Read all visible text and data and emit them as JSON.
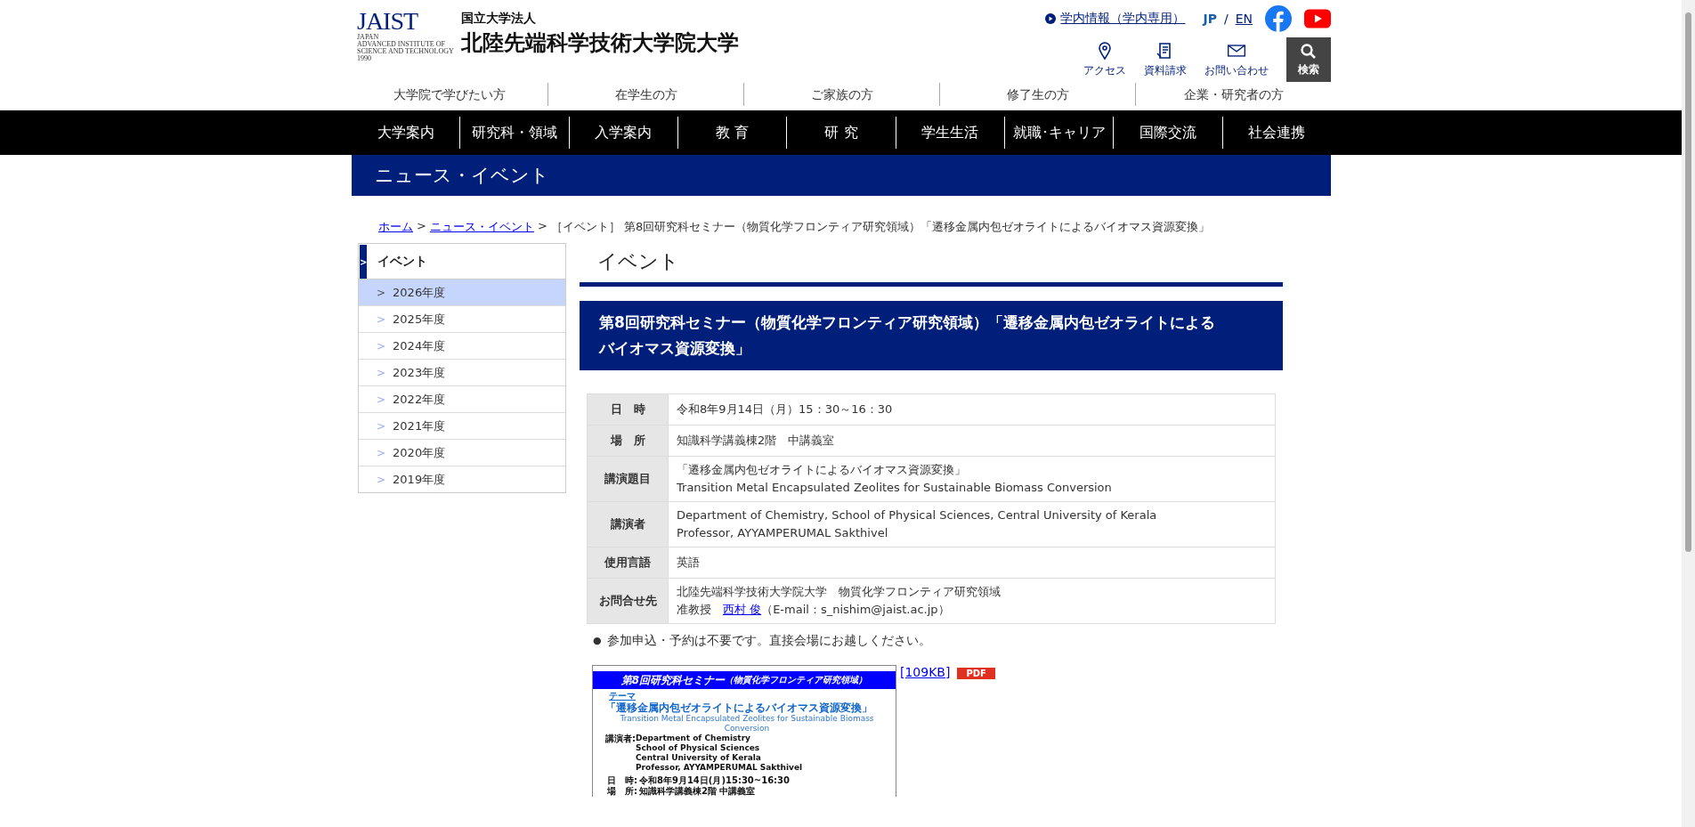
{
  "header": {
    "logo": {
      "mark": "JAIST",
      "lines": [
        "JAPAN",
        "ADVANCED INSTITUTE OF",
        "SCIENCE AND TECHNOLOGY",
        "1990"
      ]
    },
    "subtitle": "国立大学法人",
    "title": "北陸先端科学技術大学院大学",
    "internal_link": "学内情報（学内専用）",
    "languages": [
      {
        "label": "JP",
        "selected": true
      },
      {
        "label": "EN",
        "selected": false
      }
    ],
    "divider": "/",
    "utilities": [
      {
        "kind": "pin",
        "label": "アクセス"
      },
      {
        "kind": "doc",
        "label": "資料請求"
      },
      {
        "kind": "mail",
        "label": "お問い合わせ"
      }
    ],
    "search_button": "検索"
  },
  "audience_nav": [
    "大学院で学びたい方",
    "在学生の方",
    "ご家族の方",
    "修了生の方",
    "企業・研究者の方"
  ],
  "main_nav": [
    "大学案内",
    "研究科・領域",
    "入学案内",
    "教 育",
    "研 究",
    "学生生活",
    "就職･キャリア",
    "国際交流",
    "社会連携"
  ],
  "section_banner": "ニュース・イベント",
  "breadcrumb": {
    "links": [
      "ホーム",
      "ニュース・イベント"
    ],
    "separator": ">",
    "current": "［イベント］ 第8回研究科セミナー（物質化学フロンティア研究領域）「遷移金属内包ゼオライトによるバイオマス資源変換」"
  },
  "sidebar": {
    "marker": ">",
    "title": "イベント",
    "items": [
      {
        "label": "2026年度",
        "selected": true
      },
      {
        "label": "2025年度",
        "selected": false
      },
      {
        "label": "2024年度",
        "selected": false
      },
      {
        "label": "2023年度",
        "selected": false
      },
      {
        "label": "2022年度",
        "selected": false
      },
      {
        "label": "2021年度",
        "selected": false
      },
      {
        "label": "2020年度",
        "selected": false
      },
      {
        "label": "2019年度",
        "selected": false
      }
    ],
    "item_marker": ">"
  },
  "article": {
    "category": "イベント",
    "title": "第8回研究科セミナー（物質化学フロンティア研究領域）「遷移金属内包ゼオライトによるバイオマス資源変換」",
    "details": [
      {
        "label": "日　時",
        "lines": [
          "令和8年9月14日（月）15：30～16：30"
        ]
      },
      {
        "label": "場　所",
        "lines": [
          "知識科学講義棟2階　中講義室"
        ]
      },
      {
        "label": "講演題目",
        "lines": [
          "「遷移金属内包ゼオライトによるバイオマス資源変換」",
          "Transition Metal Encapsulated Zeolites for Sustainable Biomass Conversion"
        ]
      },
      {
        "label": "講演者",
        "lines": [
          "Department of Chemistry, School of Physical Sciences, Central University of Kerala",
          "Professor, AYYAMPERUMAL Sakthivel"
        ]
      },
      {
        "label": "使用言語",
        "lines": [
          "英語"
        ]
      },
      {
        "label": "お問合せ先",
        "lines": [
          "北陸先端科学技術大学院大学　物質化学フロンティア研究領域"
        ],
        "contact": {
          "prefix": "准教授　",
          "link": "西村 俊",
          "suffix": "（E-mail：s_nishim@jaist.ac.jp）"
        }
      }
    ],
    "note_bullet": "●",
    "note": "参加申込・予約は不要です。直接会場にお越しください。",
    "attachment": {
      "size": "[109KB]",
      "badge": "PDF",
      "poster": {
        "header": "第8回研究科セミナー",
        "header_sub": "（物質化学フロンティア研究領域）",
        "theme_label": "テーマ",
        "theme": "「遷移金属内包ゼオライトによるバイオマス資源変換」",
        "theme_en": "Transition Metal Encapsulated Zeolites for Sustainable Biomass Conversion",
        "speaker_label": "講演者:",
        "speaker_lines": [
          "Department of Chemistry",
          "School of Physical Sciences",
          "Central University of Kerala",
          "Professor, AYYAMPERUMAL Sakthivel"
        ],
        "facts": [
          {
            "label": "日　時:",
            "value": "令和8年9月14日(月)15:30~16:30"
          },
          {
            "label": "場　所:",
            "value": "知識科学講義棟2階  中講義室"
          }
        ]
      }
    }
  }
}
